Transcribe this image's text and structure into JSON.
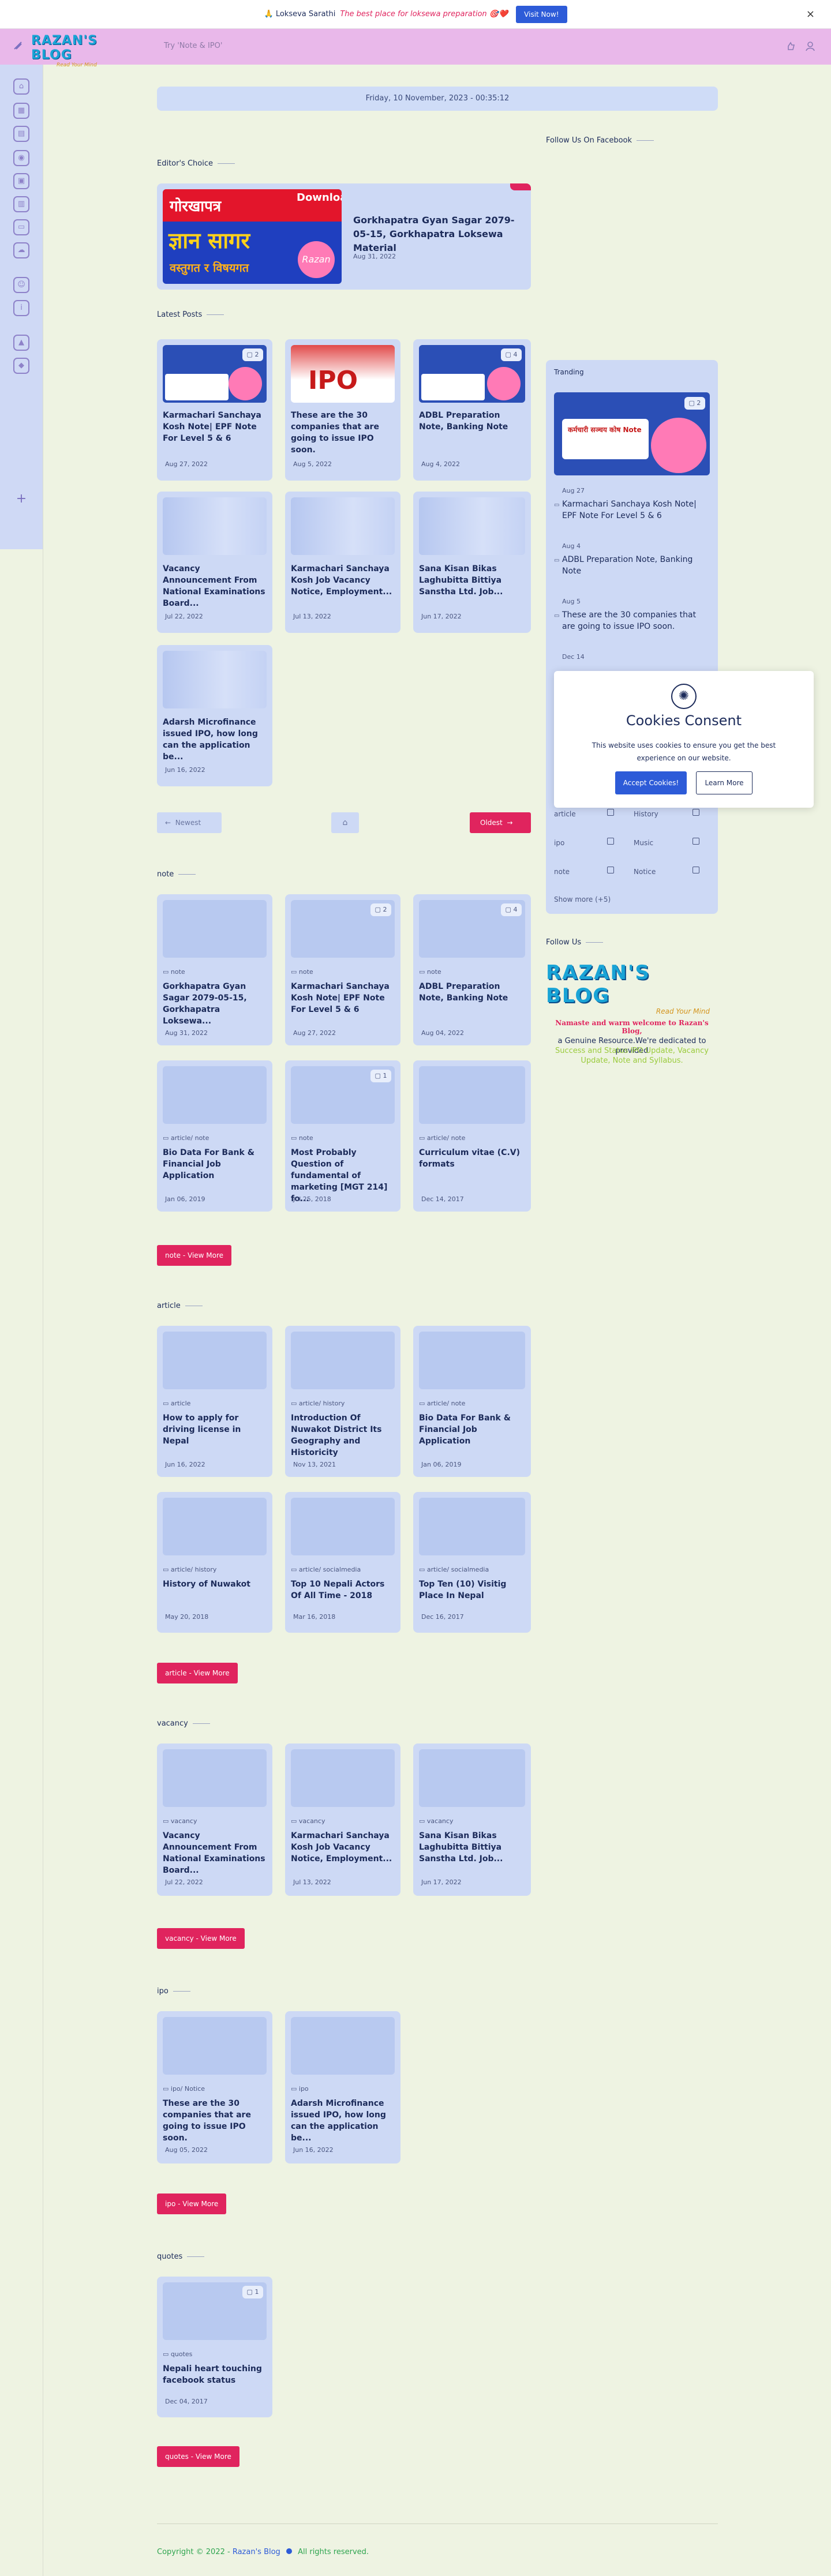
{
  "notice": {
    "brand": "🙏 Lokseva Sarathi",
    "tagline": "The best place for loksewa preparation 🎯❤️",
    "cta": "Visit Now!",
    "close": "×"
  },
  "header": {
    "logo_title": "RAZAN'S BLOG",
    "logo_sub": "Read Your Mind",
    "search_placeholder": "Try 'Note & IPO'"
  },
  "datebar": "Friday, 10 November, 2023 - 00:35:12",
  "editors_choice": {
    "heading": "Editor's Choice",
    "thumb_text_top": "गोरखापत्र",
    "thumb_text_mid": "ज्ञान सागर",
    "thumb_text_bottom": "वस्तुगत र विषयगत",
    "thumb_download": "Download",
    "thumb_brand": "Razan",
    "title": "Gorkhapatra Gyan Sagar 2079-05-15, Gorkhapatra Loksewa Material",
    "date": "Aug 31, 2022"
  },
  "latest": {
    "heading": "Latest Posts",
    "posts": [
      {
        "title": "Karmachari Sanchaya Kosh Note| EPF Note For Level 5 & 6",
        "date": "Aug 27, 2022",
        "comments": "2"
      },
      {
        "title": "These are the 30 companies that are going to issue IPO soon.",
        "date": "Aug 5, 2022",
        "comments": ""
      },
      {
        "title": "ADBL Preparation Note, Banking Note",
        "date": "Aug 4, 2022",
        "comments": "4"
      },
      {
        "title": "Vacancy Announcement From National Examinations Board...",
        "date": "Jul 22, 2022",
        "comments": ""
      },
      {
        "title": "Karmachari Sanchaya Kosh Job Vacancy Notice, Employment...",
        "date": "Jul 13, 2022",
        "comments": ""
      },
      {
        "title": "Sana Kisan Bikas Laghubitta Bittiya Sanstha Ltd. Job...",
        "date": "Jun 17, 2022",
        "comments": ""
      },
      {
        "title": "Adarsh Microfinance issued IPO, how long can the application be...",
        "date": "Jun 16, 2022",
        "comments": ""
      }
    ],
    "newest": "Newest",
    "oldest": "Oldest"
  },
  "note": {
    "heading": "note",
    "posts": [
      {
        "cat": "note",
        "title": "Gorkhapatra Gyan Sagar 2079-05-15, Gorkhapatra Loksewa...",
        "date": "Aug 31, 2022",
        "comments": ""
      },
      {
        "cat": "note",
        "title": "Karmachari Sanchaya Kosh Note| EPF Note For Level 5 & 6",
        "date": "Aug 27, 2022",
        "comments": "2"
      },
      {
        "cat": "note",
        "title": "ADBL Preparation Note, Banking Note",
        "date": "Aug 04, 2022",
        "comments": "4"
      },
      {
        "cat": "article/ note",
        "title": "Bio Data For Bank & Financial Job Application",
        "date": "Jan 06, 2019",
        "comments": ""
      },
      {
        "cat": "note",
        "title": "Most Probably Question of fundamental of marketing [MGT 214] fo...",
        "date": "Jul 25, 2018",
        "comments": "1"
      },
      {
        "cat": "article/ note",
        "title": "Curriculum vitae (C.V) formats",
        "date": "Dec 14, 2017",
        "comments": ""
      }
    ],
    "more": "note - View More"
  },
  "article": {
    "heading": "article",
    "posts": [
      {
        "cat": "article",
        "title": "How to apply for driving license in Nepal",
        "date": "Jun 16, 2022"
      },
      {
        "cat": "article/ history",
        "title": "Introduction Of Nuwakot District Its Geography and Historicity",
        "date": "Nov 13, 2021"
      },
      {
        "cat": "article/ note",
        "title": "Bio Data For Bank & Financial Job Application",
        "date": "Jan 06, 2019"
      },
      {
        "cat": "article/ history",
        "title": "History of Nuwakot",
        "date": "May 20, 2018"
      },
      {
        "cat": "article/ socialmedia",
        "title": "Top 10 Nepali Actors Of All Time - 2018",
        "date": "Mar 16, 2018"
      },
      {
        "cat": "article/ socialmedia",
        "title": "Top Ten (10) Visitig Place In Nepal",
        "date": "Dec 16, 2017"
      }
    ],
    "more": "article - View More"
  },
  "vacancy": {
    "heading": "vacancy",
    "posts": [
      {
        "cat": "vacancy",
        "title": "Vacancy Announcement From National Examinations Board...",
        "date": "Jul 22, 2022"
      },
      {
        "cat": "vacancy",
        "title": "Karmachari Sanchaya Kosh Job Vacancy Notice, Employment...",
        "date": "Jul 13, 2022"
      },
      {
        "cat": "vacancy",
        "title": "Sana Kisan Bikas Laghubitta Bittiya Sanstha Ltd. Job...",
        "date": "Jun 17, 2022"
      }
    ],
    "more": "vacancy - View More"
  },
  "ipo": {
    "heading": "ipo",
    "posts": [
      {
        "cat": "ipo/ Notice",
        "title": "These are the 30 companies that are going to issue IPO soon.",
        "date": "Aug 05, 2022"
      },
      {
        "cat": "ipo",
        "title": "Adarsh Microfinance issued IPO, how long can the application be...",
        "date": "Jun 16, 2022"
      }
    ],
    "more": "ipo - View More"
  },
  "quotes": {
    "heading": "quotes",
    "posts": [
      {
        "cat": "quotes",
        "title": "Nepali heart touching facebook status",
        "date": "Dec 04, 2017",
        "comments": "1"
      }
    ],
    "more": "quotes - View More"
  },
  "right": {
    "facebook_heading": "Follow Us On Facebook",
    "trending_heading": "Tranding",
    "trending_thumb_text": "कर्मचारी सञ्चय कोष Note",
    "trending": [
      {
        "date": "Aug 27",
        "title": "Karmachari Sanchaya Kosh Note| EPF Note For Level 5 & 6"
      },
      {
        "date": "Aug 4",
        "title": "ADBL Preparation Note, Banking Note"
      },
      {
        "date": "Aug 5",
        "title": "These are the 30 companies that are going to issue IPO soon."
      },
      {
        "date": "Dec 14",
        "title": ""
      }
    ],
    "labels": [
      {
        "name": "article",
        "side": "left"
      },
      {
        "name": "History",
        "side": "right"
      },
      {
        "name": "ipo",
        "side": "left"
      },
      {
        "name": "Music",
        "side": "right"
      },
      {
        "name": "note",
        "side": "left"
      },
      {
        "name": "Notice",
        "side": "right"
      }
    ],
    "show_more": "Show more",
    "show_more_count": "(+5)",
    "follow_heading": "Follow Us",
    "follow_logo": "RAZAN'S BLOG",
    "follow_logo_sub": "Read Your Mind",
    "welcome": "Namaste and warm welcome to Razan's Blog,",
    "desc_1": "a Genuine Resource.We're dedicated to provided",
    "desc_2": "Success and Status IPO Update, Vacancy Update, Note and Syllabus."
  },
  "cookie": {
    "title": "Cookies Consent",
    "text": "This website uses cookies to ensure you get the best experience on our website.",
    "accept": "Accept Cookies!",
    "learn": "Learn More"
  },
  "footer": {
    "copy": "Copyright © 2022 -",
    "brand": "Razan's Blog",
    "rights": "All rights reserved."
  },
  "colors": {
    "accent": "#e0245e",
    "header": "#e9b8ea",
    "card": "#cdd9f5",
    "background": "#eef3e2",
    "footer_green": "#2ea44f"
  }
}
